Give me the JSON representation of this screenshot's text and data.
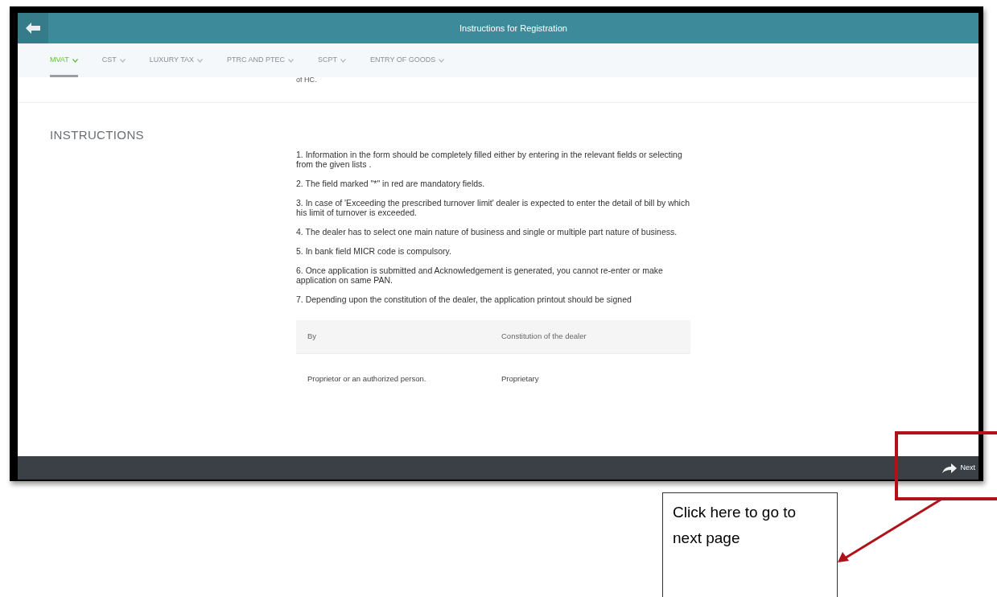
{
  "header": {
    "title": "Instructions for Registration"
  },
  "tabs": [
    {
      "label": "MVAT",
      "selected": true
    },
    {
      "label": "CST",
      "selected": false
    },
    {
      "label": "LUXURY TAX",
      "selected": false
    },
    {
      "label": "PTRC AND PTEC",
      "selected": false
    },
    {
      "label": "SCPT",
      "selected": false
    },
    {
      "label": "ENTRY OF GOODS",
      "selected": false
    }
  ],
  "partial_row": {
    "text": "of HC."
  },
  "section": {
    "heading": "INSTRUCTIONS",
    "items": [
      "1. Information in the form should be completely filled either by entering in the relevant fields or selecting from the given lists .",
      "2. The field marked \"*\" in red are mandatory fields.",
      "3. In case of 'Exceeding the prescribed turnover limit' dealer is expected to enter the detail of bill by which his limit of turnover is exceeded.",
      "4. The dealer has to select one main nature of business and single or multiple part nature of business.",
      "5. In bank field MICR code is compulsory.",
      "6. Once application is submitted and Acknowledgement is generated, you cannot re-enter or make application on same PAN.",
      "7. Depending upon the constitution of the dealer, the application printout should be signed"
    ],
    "table": {
      "columns": [
        "By",
        "Constitution of the dealer"
      ],
      "rows": [
        [
          "Proprietor or an authorized person.",
          "Proprietary"
        ]
      ]
    }
  },
  "footer": {
    "next_label": "Next"
  },
  "annotation": {
    "text": "Click here to go to next page"
  }
}
